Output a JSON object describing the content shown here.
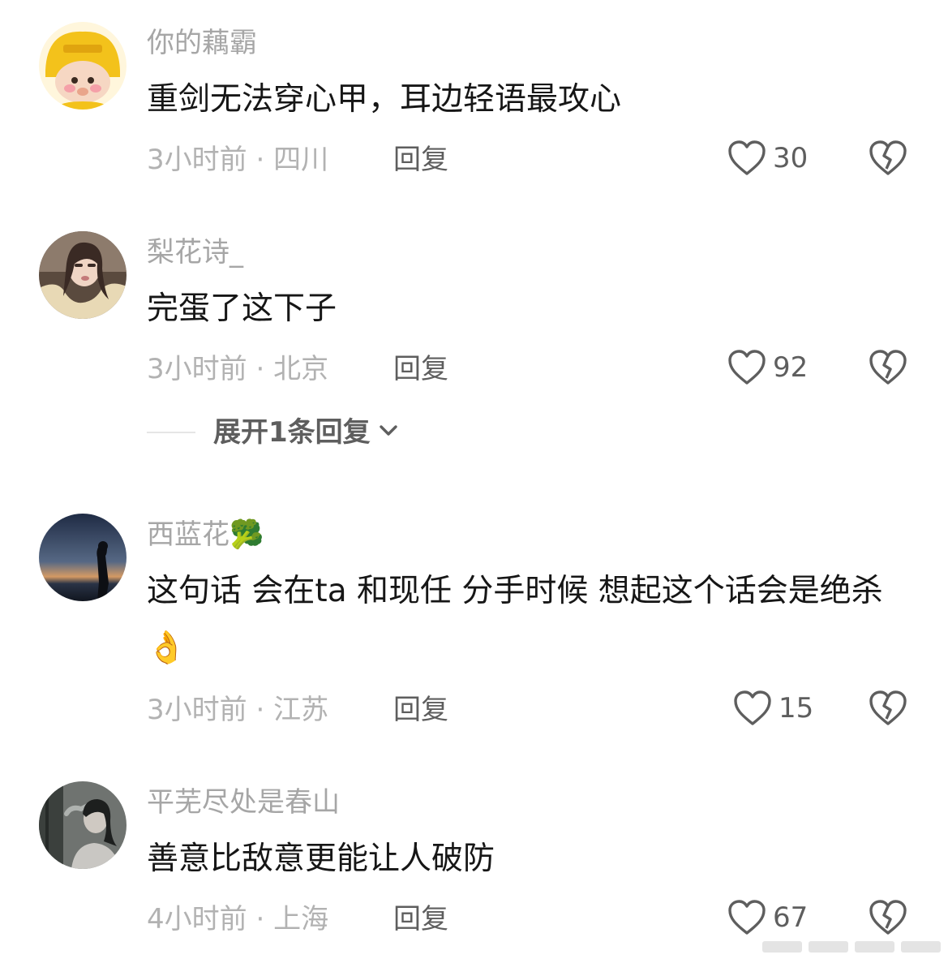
{
  "comments": [
    {
      "username": "你的藕霸",
      "text": "重剑无法穿心甲，耳边轻语最攻心",
      "time": "3小时前",
      "separator": "·",
      "location": "四川",
      "reply_label": "回复",
      "likes": "30",
      "avatar_icon": "yellow-hat-cartoon-avatar"
    },
    {
      "username": "梨花诗_",
      "text": "完蛋了这下子",
      "time": "3小时前",
      "separator": "·",
      "location": "北京",
      "reply_label": "回复",
      "likes": "92",
      "avatar_icon": "woman-photo-avatar",
      "expand_label": "展开1条回复"
    },
    {
      "username": "西蓝花",
      "username_emoji": "🥦",
      "text": "这句话 会在ta 和现任 分手时候 想起这个话会是绝杀",
      "text_emoji": "👌",
      "time": "3小时前",
      "separator": "·",
      "location": "江苏",
      "reply_label": "回复",
      "likes": "15",
      "avatar_icon": "sunset-silhouette-avatar"
    },
    {
      "username": "平芜尽处是春山",
      "text": "善意比敌意更能让人破防",
      "time": "4小时前",
      "separator": "·",
      "location": "上海",
      "reply_label": "回复",
      "likes": "67",
      "avatar_icon": "smoking-woman-avatar"
    }
  ],
  "colors": {
    "username": "#a6a6a6",
    "text": "#161616",
    "meta": "#b2b2b2",
    "action": "#5e5e5e"
  }
}
